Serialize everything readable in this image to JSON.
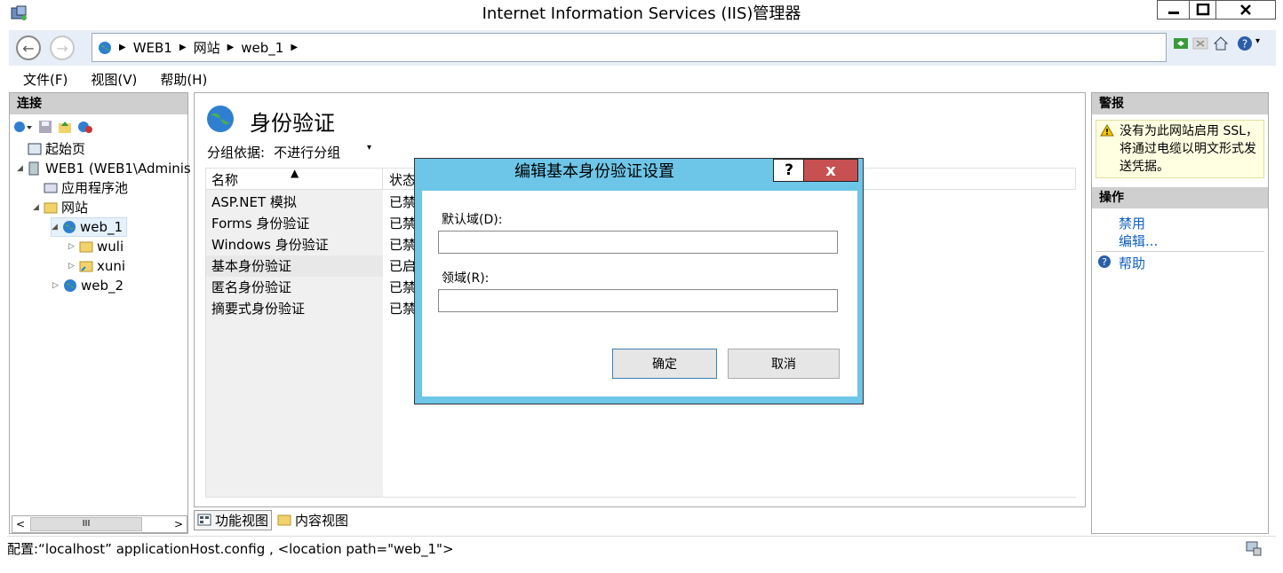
{
  "window": {
    "title": "Internet Information Services (IIS)管理器",
    "min_glyph": "—",
    "max_glyph": "☐",
    "close_glyph": "✕"
  },
  "nav": {
    "back_glyph": "←",
    "forward_glyph": "→",
    "breadcrumb": [
      "WEB1",
      "网站",
      "web_1"
    ],
    "sep_glyph": "▶"
  },
  "menu": [
    "文件(F)",
    "视图(V)",
    "帮助(H)"
  ],
  "connections": {
    "title": "连接",
    "tree": [
      {
        "label": "起始页"
      },
      {
        "label": "WEB1 (WEB1\\Adminis"
      },
      {
        "label": "应用程序池"
      },
      {
        "label": "网站"
      },
      {
        "label": "web_1"
      },
      {
        "label": "wuli"
      },
      {
        "label": "xuni"
      },
      {
        "label": "web_2"
      }
    ],
    "scroll_glyph_left": "<",
    "scroll_glyph_mid": "III",
    "scroll_glyph_right": ">"
  },
  "main": {
    "title": "身份验证",
    "group_label": "分组依据:",
    "group_value": "不进行分组",
    "columns": [
      "名称",
      "状态"
    ],
    "rows": [
      {
        "name": "ASP.NET 模拟",
        "status": "已禁"
      },
      {
        "name": "Forms 身份验证",
        "status": "已禁"
      },
      {
        "name": "Windows 身份验证",
        "status": "已禁"
      },
      {
        "name": "基本身份验证",
        "status": "已启"
      },
      {
        "name": "匿名身份验证",
        "status": "已禁"
      },
      {
        "name": "摘要式身份验证",
        "status": "已禁"
      }
    ],
    "tab_feature": "功能视图",
    "tab_content": "内容视图"
  },
  "right": {
    "alerts_title": "警报",
    "alert_text": "没有为此网站启用 SSL，将通过电缆以明文形式发送凭据。",
    "actions_title": "操作",
    "actions": [
      "禁用",
      "编辑...",
      "帮助"
    ]
  },
  "status": {
    "text": "配置:“localhost” applicationHost.config , <location path=\"web_1\">"
  },
  "dialog": {
    "title": "编辑基本身份验证设置",
    "help_glyph": "?",
    "close_glyph": "x",
    "default_domain_label": "默认域(D):",
    "default_domain_value": "",
    "realm_label": "领域(R):",
    "realm_value": "",
    "ok_label": "确定",
    "cancel_label": "取消"
  },
  "colors": {
    "dialog_frame": "#6dc6e8",
    "close_red": "#c75050",
    "link_blue": "#1060c0",
    "alert_bg": "#ffffe1"
  }
}
